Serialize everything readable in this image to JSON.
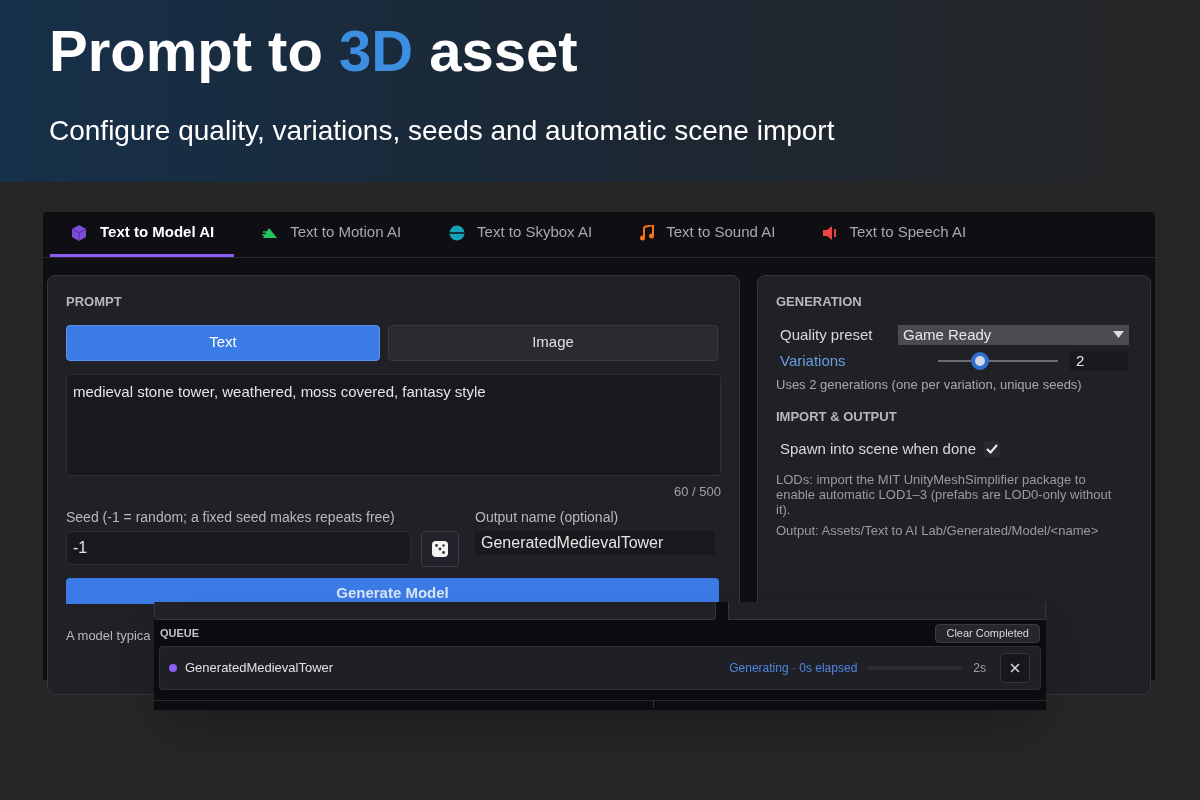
{
  "banner": {
    "title": [
      {
        "text": "Prompt to ",
        "highlight": false
      },
      {
        "text": "3D",
        "highlight": true
      },
      {
        "text": " asset",
        "highlight": false
      }
    ],
    "subtitle": "Configure quality, variations, seeds and automatic scene import"
  },
  "tabs": [
    {
      "label": "Text to Model AI",
      "selected": true,
      "kind": "cube"
    },
    {
      "label": "Text to Motion AI",
      "selected": false,
      "kind": "motion"
    },
    {
      "label": "Text to Skybox AI",
      "selected": false,
      "kind": "sphere"
    },
    {
      "label": "Text to Sound AI",
      "selected": false,
      "kind": "note"
    },
    {
      "label": "Text to Speech AI",
      "selected": false,
      "kind": "speaker"
    }
  ],
  "prompt": {
    "heading": "PROMPT",
    "modes": [
      {
        "label": "Text",
        "selected": true
      },
      {
        "label": "Image",
        "selected": false
      }
    ],
    "text": "medieval stone tower, weathered, moss covered, fantasy style",
    "counter": "60 / 500",
    "seed_label": "Seed (-1 = random; a fixed seed makes repeats free)",
    "seed_value": "-1",
    "output_label": "Output name (optional)",
    "output_value": "GeneratedMedievalTower",
    "generate_button": "Generate Model",
    "note": "A model typica"
  },
  "generation": {
    "heading": "GENERATION",
    "quality_label": "Quality preset",
    "quality_value": "Game Ready",
    "variations_label": "Variations",
    "variations": {
      "level": 0.35,
      "value": "2"
    },
    "variations_note": "Uses 2 generations (one per variation, unique seeds)",
    "import_heading": "IMPORT & OUTPUT",
    "spawn_label": "Spawn into scene when done",
    "spawn_checked": true,
    "lod_note": "LODs: import the MIT UnityMeshSimplifier package to enable automatic LOD1–3 (prefabs are LOD0-only without it).",
    "output_note": "Output: Assets/Text to AI Lab/Generated/Model/<name>"
  },
  "queue": {
    "heading": "QUEUE",
    "clear_button": "Clear Completed",
    "items": [
      {
        "name": "GeneratedMedievalTower",
        "color": "#8b5cf6",
        "status": "Generating · 0s elapsed",
        "time": "2s"
      }
    ]
  }
}
